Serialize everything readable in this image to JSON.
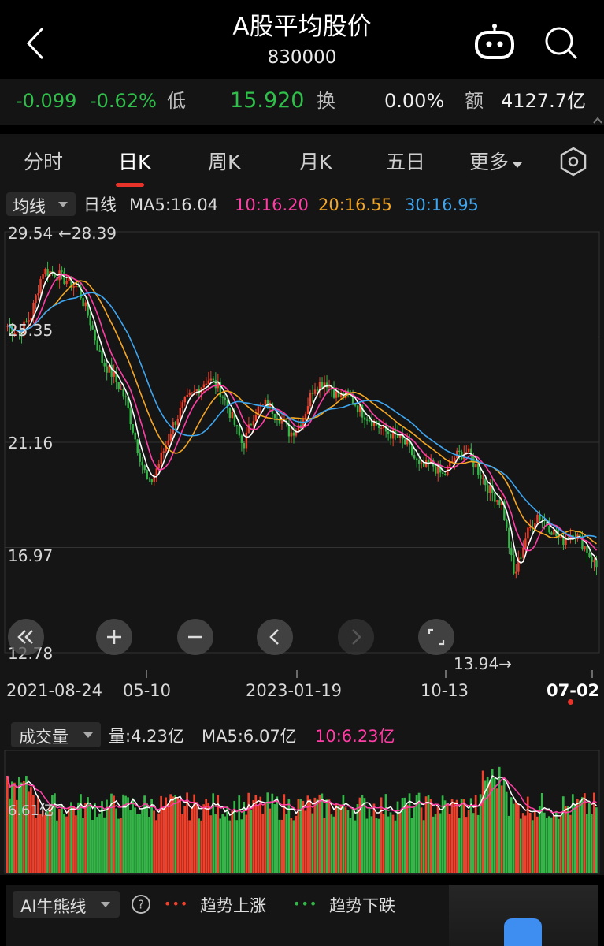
{
  "header": {
    "title": "A股平均股价",
    "code": "830000"
  },
  "quote": {
    "change": "-0.099",
    "change_pct": "-0.62%",
    "low_label": "低",
    "low_value": "15.920",
    "turnover_label": "换",
    "turnover_value": "0.00%",
    "amount_label": "额",
    "amount_value": "4127.7亿"
  },
  "tabs": [
    "分时",
    "日K",
    "周K",
    "月K",
    "五日",
    "更多"
  ],
  "active_tab": "日K",
  "ma_bar": {
    "selector": "均线",
    "period": "日线",
    "ma5": "MA5:16.04",
    "ma10": "10:16.20",
    "ma20": "20:16.55",
    "ma30": "30:16.95"
  },
  "colors": {
    "up": "#f0412c",
    "down": "#33b847",
    "ma5": "#ffffff",
    "ma10": "#ff3ea5",
    "ma20": "#f5a623",
    "ma30": "#3ea6f0"
  },
  "price_axis": {
    "labels": [
      "29.54",
      "25.35",
      "21.16",
      "16.97",
      "12.78"
    ],
    "max_marker": "←28.39",
    "min_marker": "13.94→"
  },
  "date_axis": [
    "2021-08-24",
    "05-10",
    "2023-01-19",
    "10-13",
    "07-02"
  ],
  "controls": [
    "rewind-icon",
    "zoom-in-icon",
    "zoom-out-icon",
    "prev-icon",
    "next-icon",
    "fullscreen-icon"
  ],
  "volume": {
    "selector": "成交量",
    "vol": "量:4.23亿",
    "ma5": "MA5:6.07亿",
    "ma10": "10:6.23亿",
    "axis_label": "6.61亿"
  },
  "ai": {
    "selector": "AI牛熊线",
    "help_icon": "help-icon",
    "up_legend": "趋势上涨",
    "down_legend": "趋势下跌"
  },
  "chart_data": {
    "type": "candlestick",
    "ylim": [
      12.78,
      29.54
    ],
    "dates": [
      "2021-08-24",
      "05-10",
      "2023-01-19",
      "10-13",
      "07-02"
    ],
    "close_trend": [
      25.8,
      25.5,
      26.2,
      28.0,
      27.9,
      27.6,
      27.3,
      26.0,
      24.4,
      23.8,
      22.9,
      21.0,
      19.4,
      20.5,
      21.8,
      22.7,
      23.2,
      23.7,
      23.3,
      22.2,
      21.0,
      22.4,
      22.7,
      22.2,
      21.5,
      22.0,
      23.4,
      23.6,
      23.0,
      23.0,
      22.4,
      22.0,
      21.6,
      21.4,
      21.0,
      20.1,
      20.3,
      19.8,
      20.6,
      20.8,
      20.0,
      19.2,
      18.7,
      15.8,
      17.4,
      18.3,
      17.8,
      17.2,
      17.6,
      17.0,
      16.2
    ],
    "high": 28.39,
    "low": 13.94
  }
}
